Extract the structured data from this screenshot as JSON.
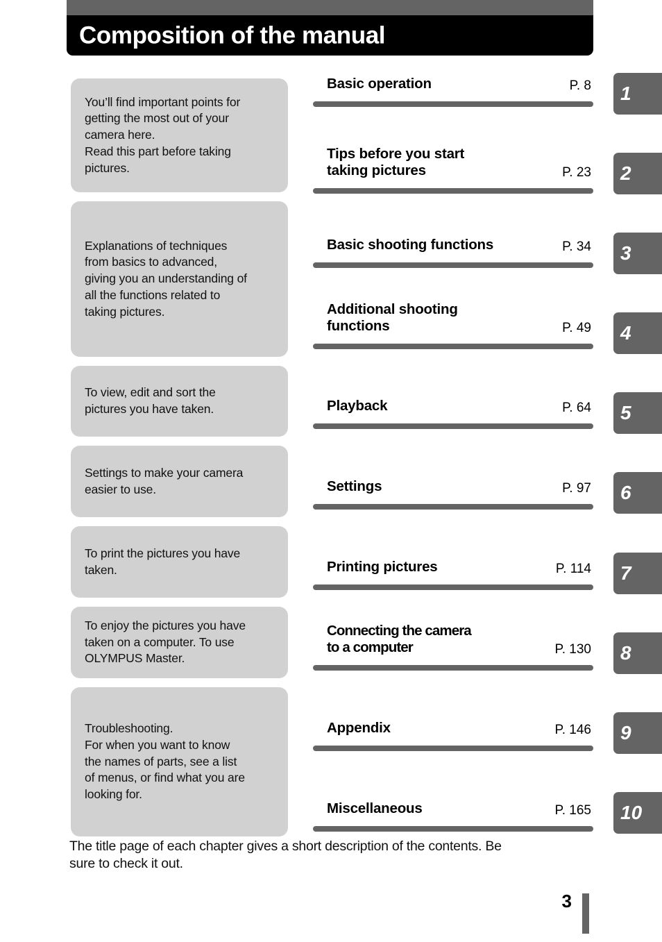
{
  "header": {
    "title": "Composition of the manual",
    "graybar_color": "#646464",
    "titlebar_color": "#000000"
  },
  "descriptions": [
    {
      "id": "desc-basic-operation",
      "text": "You’ll find important points for\ngetting the most out of your\ncamera here.\nRead this part before taking\npictures."
    },
    {
      "id": "desc-shooting-functions",
      "text": "Explanations of techniques\nfrom basics to advanced,\ngiving you an understanding of\nall the functions related to\ntaking pictures."
    },
    {
      "id": "desc-playback",
      "text": "To view, edit and sort the\npictures you have taken."
    },
    {
      "id": "desc-settings",
      "text": "Settings to make your camera\neasier to use."
    },
    {
      "id": "desc-printing",
      "text": "To print the pictures you have\ntaken."
    },
    {
      "id": "desc-computer",
      "text": "To enjoy the pictures you have\ntaken on a computer. To use\nOLYMPUS Master."
    },
    {
      "id": "desc-appendix",
      "text": "Troubleshooting.\nFor when you want to know\nthe names of parts, see a list\nof menus, or find what you are\nlooking for."
    }
  ],
  "chapters": [
    {
      "title": "Basic operation",
      "page": "P. 8"
    },
    {
      "title": "Tips before you start\ntaking pictures",
      "page": "P. 23"
    },
    {
      "title": "Basic shooting functions",
      "page": "P. 34"
    },
    {
      "title": "Additional shooting\nfunctions",
      "page": "P. 49"
    },
    {
      "title": "Playback",
      "page": "P. 64"
    },
    {
      "title": "Settings",
      "page": "P. 97"
    },
    {
      "title": "Printing pictures",
      "page": "P. 114"
    },
    {
      "title": "Connecting the camera\nto a computer",
      "page": "P. 130"
    },
    {
      "title": "Appendix",
      "page": "P. 146"
    },
    {
      "title": "Miscellaneous",
      "page": "P. 165"
    }
  ],
  "tabs": [
    {
      "label": "1"
    },
    {
      "label": "2"
    },
    {
      "label": "3"
    },
    {
      "label": "4"
    },
    {
      "label": "5"
    },
    {
      "label": "6"
    },
    {
      "label": "7"
    },
    {
      "label": "8"
    },
    {
      "label": "9"
    },
    {
      "label": "10"
    }
  ],
  "footer": {
    "caption": "The title page of each chapter gives a short description of the contents. Be\nsure to check it out.",
    "page_number": "3"
  },
  "colors": {
    "box_gray": "#d1d1d1",
    "accent_gray": "#646464",
    "black": "#000000",
    "white": "#ffffff"
  }
}
